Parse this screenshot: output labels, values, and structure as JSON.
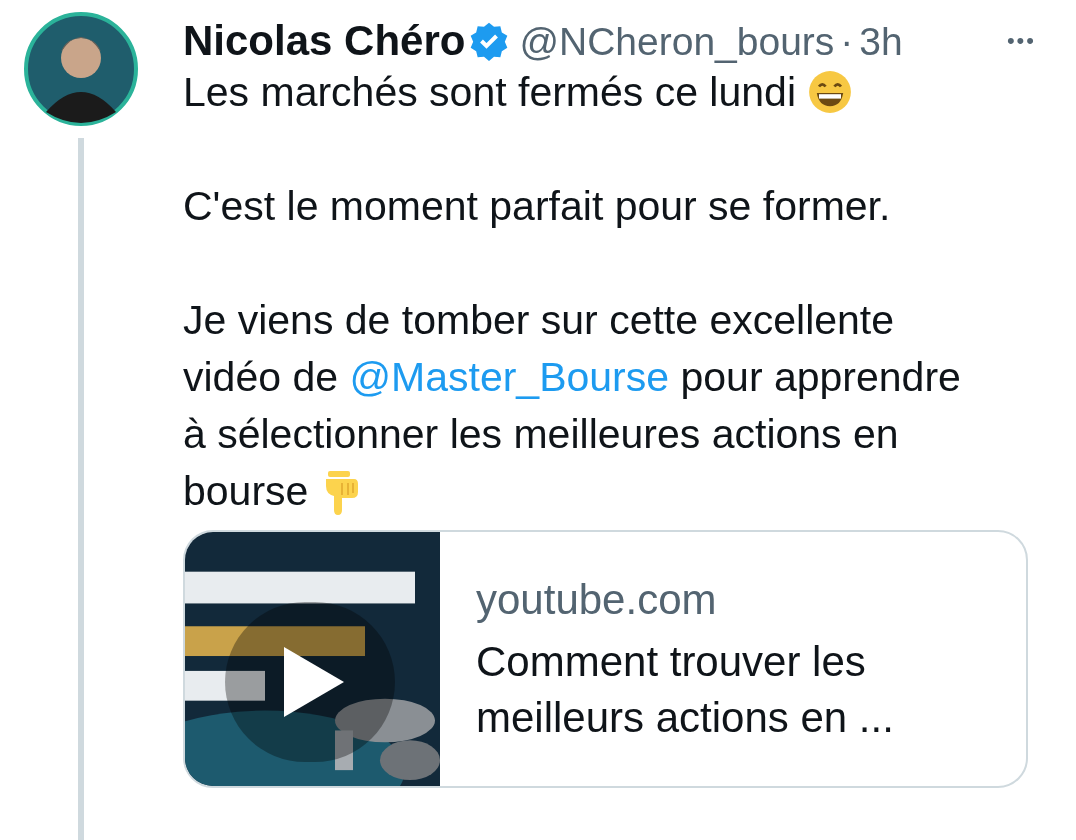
{
  "author": {
    "name": "Nicolas Chéro",
    "verified": true,
    "handle": "@NCheron_bours",
    "separator": "·",
    "time": "3h"
  },
  "more": "•••",
  "paragraphs": [
    [
      {
        "kind": "text",
        "text": "Les marchés sont fermés ce lundi"
      },
      {
        "kind": "grin_emoji"
      }
    ],
    [
      {
        "kind": "text",
        "text": "C'est le moment parfait pour se former."
      }
    ],
    [
      {
        "kind": "text",
        "text": "Je viens de tomber sur cette excellente vidéo de"
      },
      {
        "kind": "mention",
        "text": "@Master_Bourse"
      },
      {
        "kind": "text",
        "text": "pour apprendre à sélectionner les meilleures actions en bourse"
      },
      {
        "kind": "point_down_emoji"
      }
    ]
  ],
  "card": {
    "thumbnail": {
      "kind": "picture",
      "playable": true
    },
    "domain": "youtube.com",
    "title": "Comment trouver les meilleurs actions en ..."
  }
}
